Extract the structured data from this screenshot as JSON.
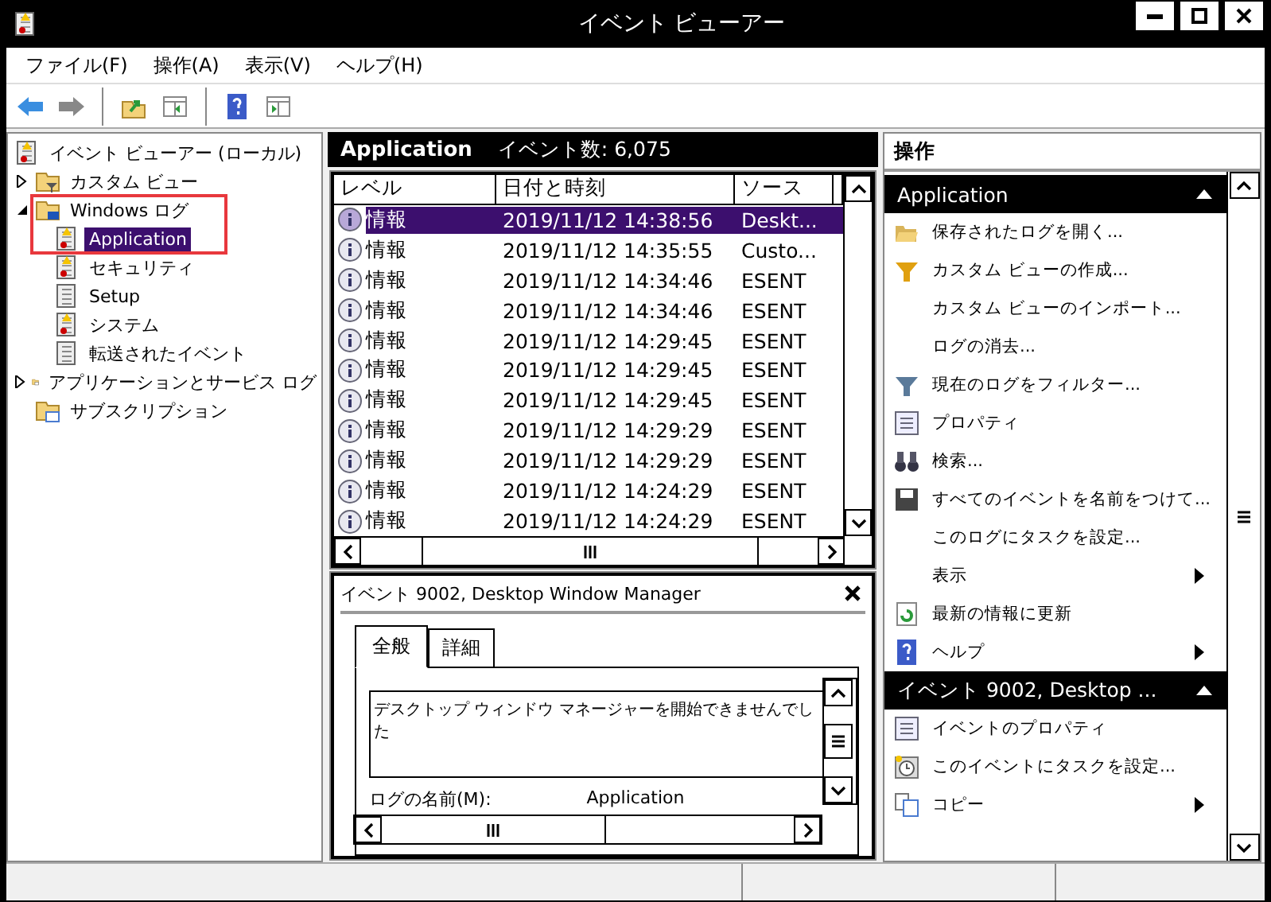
{
  "window": {
    "title": "イベント ビューアー"
  },
  "menu": [
    {
      "label": "ファイル(F)"
    },
    {
      "label": "操作(A)"
    },
    {
      "label": "表示(V)"
    },
    {
      "label": "ヘルプ(H)"
    }
  ],
  "toolbar": [
    {
      "kind": "back"
    },
    {
      "kind": "forward"
    },
    {
      "kind": "sep"
    },
    {
      "kind": "folder-up"
    },
    {
      "kind": "pane-left"
    },
    {
      "kind": "sep"
    },
    {
      "kind": "help"
    },
    {
      "kind": "pane-right"
    }
  ],
  "tree": [
    {
      "label": "イベント ビューアー (ローカル)",
      "kind": "log-warn",
      "selected": false,
      "children": [
        {
          "label": "カスタム ビュー",
          "kind": "folder-filter",
          "expanded": false,
          "selected": false
        },
        {
          "label": "Windows ログ",
          "kind": "folder-pc",
          "expanded": true,
          "selected": false,
          "highlighted": true,
          "children": [
            {
              "label": "Application",
              "kind": "log-warn",
              "selected": true
            },
            {
              "label": "セキュリティ",
              "kind": "log-warn",
              "selected": false
            },
            {
              "label": "Setup",
              "kind": "log",
              "selected": false
            },
            {
              "label": "システム",
              "kind": "log-warn",
              "selected": false
            },
            {
              "label": "転送されたイベント",
              "kind": "log",
              "selected": false
            }
          ]
        },
        {
          "label": "アプリケーションとサービス ログ",
          "kind": "folder-log",
          "expanded": false,
          "selected": false
        },
        {
          "label": "サブスクリプション",
          "kind": "folder-sub",
          "selected": false
        }
      ]
    }
  ],
  "log_header": {
    "title": "Application",
    "count": "イベント数: 6,075"
  },
  "table": {
    "columns": [
      {
        "label": "レベル"
      },
      {
        "label": "日付と時刻"
      },
      {
        "label": "ソース"
      }
    ],
    "rows": [
      {
        "level": "情報",
        "time": "2019/11/12 14:38:56",
        "source": "Deskt...",
        "selected": true
      },
      {
        "level": "情報",
        "time": "2019/11/12 14:35:55",
        "source": "Custo...",
        "selected": false
      },
      {
        "level": "情報",
        "time": "2019/11/12 14:34:46",
        "source": "ESENT",
        "selected": false
      },
      {
        "level": "情報",
        "time": "2019/11/12 14:34:46",
        "source": "ESENT",
        "selected": false
      },
      {
        "level": "情報",
        "time": "2019/11/12 14:29:45",
        "source": "ESENT",
        "selected": false
      },
      {
        "level": "情報",
        "time": "2019/11/12 14:29:45",
        "source": "ESENT",
        "selected": false
      },
      {
        "level": "情報",
        "time": "2019/11/12 14:29:45",
        "source": "ESENT",
        "selected": false
      },
      {
        "level": "情報",
        "time": "2019/11/12 14:29:29",
        "source": "ESENT",
        "selected": false
      },
      {
        "level": "情報",
        "time": "2019/11/12 14:29:29",
        "source": "ESENT",
        "selected": false
      },
      {
        "level": "情報",
        "time": "2019/11/12 14:24:29",
        "source": "ESENT",
        "selected": false
      },
      {
        "level": "情報",
        "time": "2019/11/12 14:24:29",
        "source": "ESENT",
        "selected": false
      }
    ]
  },
  "detail": {
    "title": "イベント 9002, Desktop Window Manager",
    "tabs": [
      {
        "label": "全般",
        "selected": true
      },
      {
        "label": "詳細",
        "selected": false
      }
    ],
    "description": "デスクトップ ウィンドウ マネージャーを開始できませんでした",
    "fields": [
      {
        "label": "ログの名前(M):",
        "value": "Application"
      }
    ]
  },
  "actions": {
    "title": "操作",
    "sections": [
      {
        "title": "Application",
        "expanded": true,
        "items": [
          {
            "label": "保存されたログを開く...",
            "kind": "folder-open",
            "submenu": false
          },
          {
            "label": "カスタム ビューの作成...",
            "kind": "funnel-gold",
            "submenu": false
          },
          {
            "label": "カスタム ビューのインポート...",
            "submenu": false
          },
          {
            "label": "ログの消去...",
            "submenu": false
          },
          {
            "label": "現在のログをフィルター...",
            "kind": "funnel",
            "submenu": false
          },
          {
            "label": "プロパティ",
            "kind": "sheet",
            "submenu": false
          },
          {
            "label": "検索...",
            "kind": "binoculars",
            "submenu": false
          },
          {
            "label": "すべてのイベントを名前をつけて...",
            "kind": "disk",
            "submenu": false
          },
          {
            "label": "このログにタスクを設定...",
            "submenu": false
          },
          {
            "label": "表示",
            "submenu": true
          },
          {
            "label": "最新の情報に更新",
            "kind": "refresh",
            "submenu": false
          },
          {
            "label": "ヘルプ",
            "kind": "help",
            "submenu": true
          }
        ]
      },
      {
        "title": "イベント 9002, Desktop ...",
        "expanded": true,
        "items": [
          {
            "label": "イベントのプロパティ",
            "kind": "sheet",
            "submenu": false
          },
          {
            "label": "このイベントにタスクを設定...",
            "kind": "clock",
            "submenu": false
          },
          {
            "label": "コピー",
            "kind": "copy",
            "submenu": true
          }
        ]
      }
    ]
  }
}
